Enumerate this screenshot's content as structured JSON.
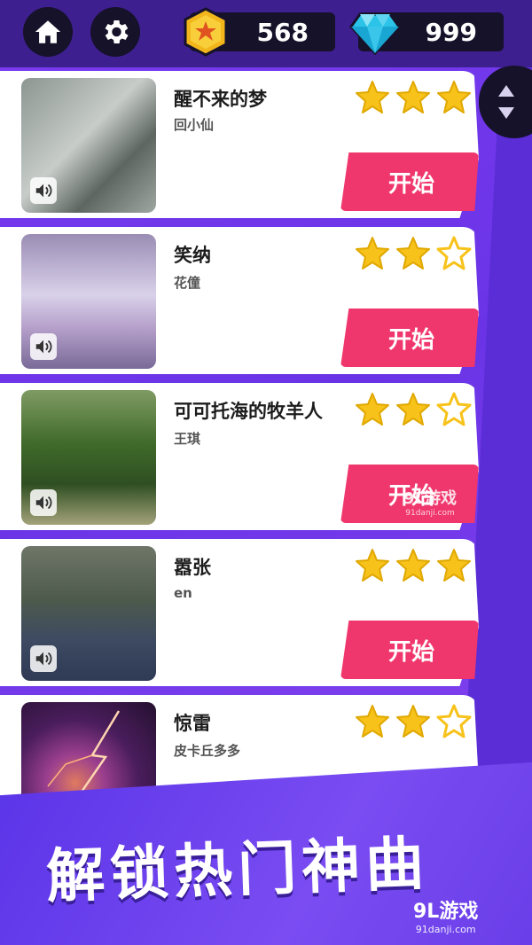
{
  "header": {
    "coins": "568",
    "gems": "999",
    "icons": [
      "home-icon",
      "gear-icon",
      "coin-icon",
      "diamond-icon"
    ]
  },
  "songs": [
    {
      "title": "醒不来的梦",
      "artist": "回小仙",
      "stars": 3,
      "start_label": "开始"
    },
    {
      "title": "笑纳",
      "artist": "花僮",
      "stars": 2,
      "start_label": "开始"
    },
    {
      "title": "可可托海的牧羊人",
      "artist": "王琪",
      "stars": 2,
      "start_label": "开始"
    },
    {
      "title": "嚣张",
      "artist": "en",
      "stars": 3,
      "start_label": "开始"
    },
    {
      "title": "惊雷",
      "artist": "皮卡丘多多",
      "stars": 2,
      "start_label": ""
    }
  ],
  "banner": {
    "text": "解锁热门神曲"
  },
  "watermark": {
    "logo": "9L游戏",
    "url": "91danji.com"
  },
  "colors": {
    "background": "#7a3cf0",
    "topbar": "#3e1f8f",
    "start_button": "#f0376d",
    "star_filled": "#f7c21a",
    "star_empty": "#ffffff"
  }
}
